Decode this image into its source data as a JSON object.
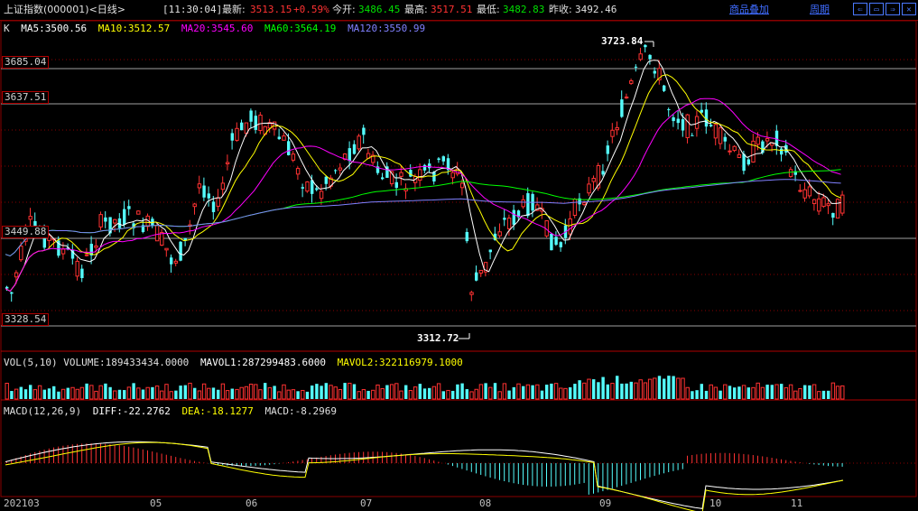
{
  "title_bar": {
    "index_name": "上证指数",
    "code": "(000001)",
    "period": "<日线>",
    "time": "[11:30:04]",
    "latest_label": "最新:",
    "latest_value": "3513.15",
    "change": "+0.59%",
    "open_label": "今开:",
    "open_value": "3486.45",
    "high_label": "最高:",
    "high_value": "3517.51",
    "low_label": "最低:",
    "low_value": "3482.83",
    "prev_close_label": "昨收:",
    "prev_close_value": "3492.46",
    "overlay_link": "商品叠加",
    "period_link": "周期"
  },
  "ma_legend": {
    "k": "K",
    "ma5": "MA5:3500.56",
    "ma10": "MA10:3512.57",
    "ma20": "MA20:3545.60",
    "ma60": "MA60:3564.19",
    "ma120": "MA120:3550.99"
  },
  "price_axis": {
    "labels": [
      "3685.04",
      "3637.51",
      "3449.88",
      "3328.54"
    ],
    "high_annotation": "3723.84",
    "low_annotation": "3312.72"
  },
  "volume_legend": {
    "name": "VOL(5,10)",
    "volume": "VOLUME:189433434.0000",
    "mavol1": "MAVOL1:287299483.6000",
    "mavol2": "MAVOL2:322116979.1000"
  },
  "macd_legend": {
    "name": "MACD(12,26,9)",
    "diff": "DIFF:-22.2762",
    "dea": "DEA:-18.1277",
    "macd": "MACD:-8.2969"
  },
  "date_axis": [
    "202103",
    "05",
    "06",
    "07",
    "08",
    "09",
    "10",
    "11"
  ],
  "colors": {
    "up": "#ff3232",
    "down": "#54fcfc",
    "ma5": "#ffffff",
    "ma10": "#ffff00",
    "ma20": "#ff00ff",
    "ma60": "#00ff00",
    "ma120": "#8080ff",
    "grid": "#8a0000",
    "link": "#3f6cff"
  }
}
